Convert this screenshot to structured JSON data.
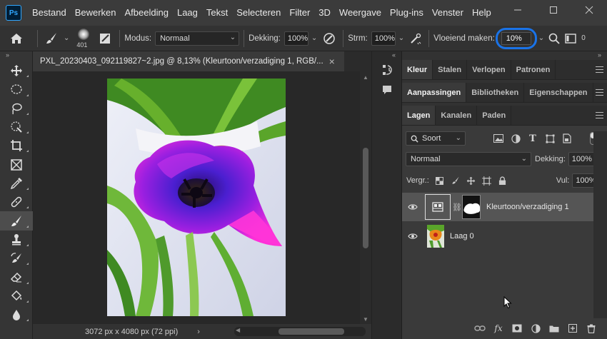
{
  "app": {
    "logo": "Ps",
    "menu": [
      "Bestand",
      "Bewerken",
      "Afbeelding",
      "Laag",
      "Tekst",
      "Selecteren",
      "Filter",
      "3D",
      "Weergave",
      "Plug-ins",
      "Venster",
      "Help"
    ]
  },
  "options": {
    "brush_size": "401",
    "mode_label": "Modus:",
    "mode_value": "Normaal",
    "opacity_label": "Dekking:",
    "opacity_value": "100%",
    "flow_label": "Strm:",
    "flow_value": "100%",
    "smoothing_label": "Vloeiend maken:",
    "smoothing_value": "10%",
    "angle_value": "0"
  },
  "document": {
    "tab_title": "PXL_20230403_092119827~2.jpg @ 8,13% (Kleurtoon/verzadiging 1, RGB/...",
    "tab_close": "×",
    "status": "3072 px x 4080 px (72 ppi)",
    "status_arrow": "›"
  },
  "panels": {
    "group1_tabs": [
      "Kleur",
      "Stalen",
      "Verlopen",
      "Patronen"
    ],
    "group2_tabs": [
      "Aanpassingen",
      "Bibliotheken",
      "Eigenschappen"
    ],
    "group3_tabs": [
      "Lagen",
      "Kanalen",
      "Paden"
    ]
  },
  "layers_panel": {
    "filter_kind": "Soort",
    "blend_mode": "Normaal",
    "opacity_label": "Dekking:",
    "opacity_value": "100%",
    "lock_label": "Vergr.:",
    "fill_label": "Vul:",
    "fill_value": "100%",
    "layers": [
      {
        "name": "Kleurtoon/verzadiging 1",
        "selected": true
      },
      {
        "name": "Laag 0",
        "selected": false
      }
    ],
    "fx_label": "fx"
  },
  "colors": {
    "selection_ring": "#1a73e8",
    "ps_blue": "#31a8ff"
  }
}
